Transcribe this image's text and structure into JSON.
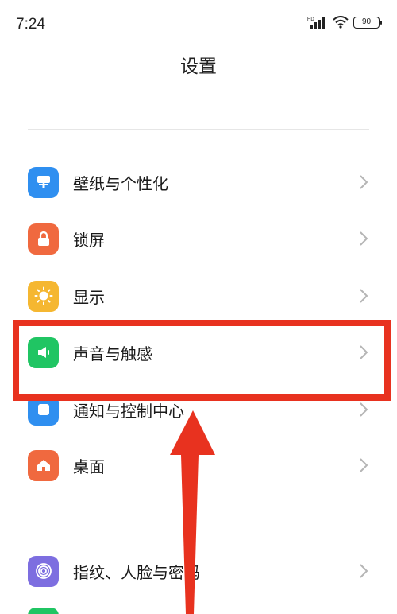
{
  "status_bar": {
    "time": "7:24",
    "battery_level": "90",
    "network_badge": "HD",
    "icons": [
      "signal-icon",
      "wifi-icon",
      "battery-icon"
    ]
  },
  "header": {
    "title": "设置"
  },
  "settings_items": [
    {
      "label": "壁纸与个性化",
      "icon": "wallpaper-icon",
      "color": "#2f8ff0"
    },
    {
      "label": "锁屏",
      "icon": "lock-icon",
      "color": "#f0693f"
    },
    {
      "label": "显示",
      "icon": "sun-icon",
      "color": "#f5b731"
    },
    {
      "label": "声音与触感",
      "icon": "speaker-icon",
      "color": "#20c563"
    },
    {
      "label": "通知与控制中心",
      "icon": "notification-icon",
      "color": "#2f8ff0"
    },
    {
      "label": "桌面",
      "icon": "home-icon",
      "color": "#f0693f"
    },
    {
      "label": "指纹、人脸与密码",
      "icon": "fingerprint-icon",
      "color": "#7d6ee0"
    }
  ],
  "annotation": {
    "highlighted_item": "声音与触感",
    "highlight_color": "#e8321f"
  }
}
